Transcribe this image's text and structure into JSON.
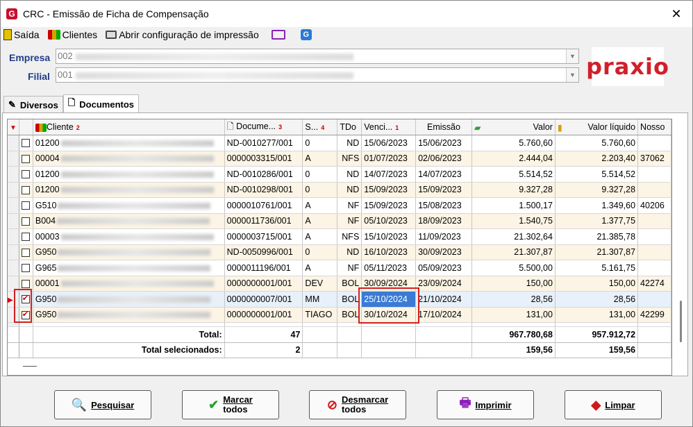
{
  "window": {
    "title": "CRC - Emissão de Ficha de Compensação"
  },
  "toolbar": {
    "saida": "Saída",
    "clientes": "Clientes",
    "config": "Abrir configuração de impressão"
  },
  "form": {
    "empresa_label": "Empresa",
    "empresa_value": "002",
    "filial_label": "Filial",
    "filial_value": "001",
    "logo_text": "praxio"
  },
  "tabs": [
    "Diversos",
    "Documentos"
  ],
  "grid": {
    "headers": [
      "Cliente",
      "Docume...",
      "S...",
      "TDo",
      "Venci...",
      "Emissão",
      "Valor",
      "Valor líquido",
      "Nosso"
    ],
    "sort_marks": {
      "cliente": "2",
      "documento": "3",
      "serie": "4",
      "vencimento": "1"
    },
    "rows": [
      {
        "checked": false,
        "cliente": "01200",
        "doc": "ND-0010277/001",
        "serie": "0",
        "tdo": "ND",
        "venc": "15/06/2023",
        "emissao": "15/06/2023",
        "valor": "5.760,60",
        "liquido": "5.760,60",
        "nosso": ""
      },
      {
        "checked": false,
        "cliente": "00004",
        "doc": "0000003315/001",
        "serie": "A",
        "tdo": "NFS",
        "venc": "01/07/2023",
        "emissao": "02/06/2023",
        "valor": "2.444,04",
        "liquido": "2.203,40",
        "nosso": "37062"
      },
      {
        "checked": false,
        "cliente": "01200",
        "doc": "ND-0010286/001",
        "serie": "0",
        "tdo": "ND",
        "venc": "14/07/2023",
        "emissao": "14/07/2023",
        "valor": "5.514,52",
        "liquido": "5.514,52",
        "nosso": ""
      },
      {
        "checked": false,
        "cliente": "01200",
        "doc": "ND-0010298/001",
        "serie": "0",
        "tdo": "ND",
        "venc": "15/09/2023",
        "emissao": "15/09/2023",
        "valor": "9.327,28",
        "liquido": "9.327,28",
        "nosso": ""
      },
      {
        "checked": false,
        "cliente": "G510",
        "doc": "0000010761/001",
        "serie": "A",
        "tdo": "NF",
        "venc": "15/09/2023",
        "emissao": "15/08/2023",
        "valor": "1.500,17",
        "liquido": "1.349,60",
        "nosso": "40206"
      },
      {
        "checked": false,
        "cliente": "B004",
        "doc": "0000011736/001",
        "serie": "A",
        "tdo": "NF",
        "venc": "05/10/2023",
        "emissao": "18/09/2023",
        "valor": "1.540,75",
        "liquido": "1.377,75",
        "nosso": ""
      },
      {
        "checked": false,
        "cliente": "00003",
        "doc": "0000003715/001",
        "serie": "A",
        "tdo": "NFS",
        "venc": "15/10/2023",
        "emissao": "11/09/2023",
        "valor": "21.302,64",
        "liquido": "21.385,78",
        "nosso": ""
      },
      {
        "checked": false,
        "cliente": "G950",
        "doc": "ND-0050996/001",
        "serie": "0",
        "tdo": "ND",
        "venc": "16/10/2023",
        "emissao": "30/09/2023",
        "valor": "21.307,87",
        "liquido": "21.307,87",
        "nosso": ""
      },
      {
        "checked": false,
        "cliente": "G965",
        "doc": "0000011196/001",
        "serie": "A",
        "tdo": "NF",
        "venc": "05/11/2023",
        "emissao": "05/09/2023",
        "valor": "5.500,00",
        "liquido": "5.161,75",
        "nosso": ""
      },
      {
        "checked": false,
        "cliente": "00001",
        "doc": "0000000001/001",
        "serie": "DEV",
        "tdo": "BOL",
        "venc": "30/09/2024",
        "emissao": "23/09/2024",
        "valor": "150,00",
        "liquido": "150,00",
        "nosso": "42274"
      },
      {
        "checked": true,
        "cliente": "G950",
        "doc": "0000000007/001",
        "serie": "MM",
        "tdo": "BOL",
        "venc": "25/10/2024",
        "emissao": "21/10/2024",
        "valor": "28,56",
        "liquido": "28,56",
        "nosso": ""
      },
      {
        "checked": true,
        "cliente": "G950",
        "doc": "0000000001/001",
        "serie": "TIAGO",
        "tdo": "BOL",
        "venc": "30/10/2024",
        "emissao": "17/10/2024",
        "valor": "131,00",
        "liquido": "131,00",
        "nosso": "42299"
      }
    ],
    "total_label": "Total:",
    "total_count": "47",
    "total_valor": "967.780,68",
    "total_liquido": "957.912,72",
    "sel_label": "Total selecionados:",
    "sel_count": "2",
    "sel_valor": "159,56",
    "sel_liquido": "159,56"
  },
  "buttons": {
    "pesquisar": "Pesquisar",
    "marcar_1": "Marcar",
    "marcar_2": "todos",
    "desmarcar_1": "Desmarcar",
    "desmarcar_2": "todos",
    "imprimir": "Imprimir",
    "limpar": "Limpar"
  }
}
